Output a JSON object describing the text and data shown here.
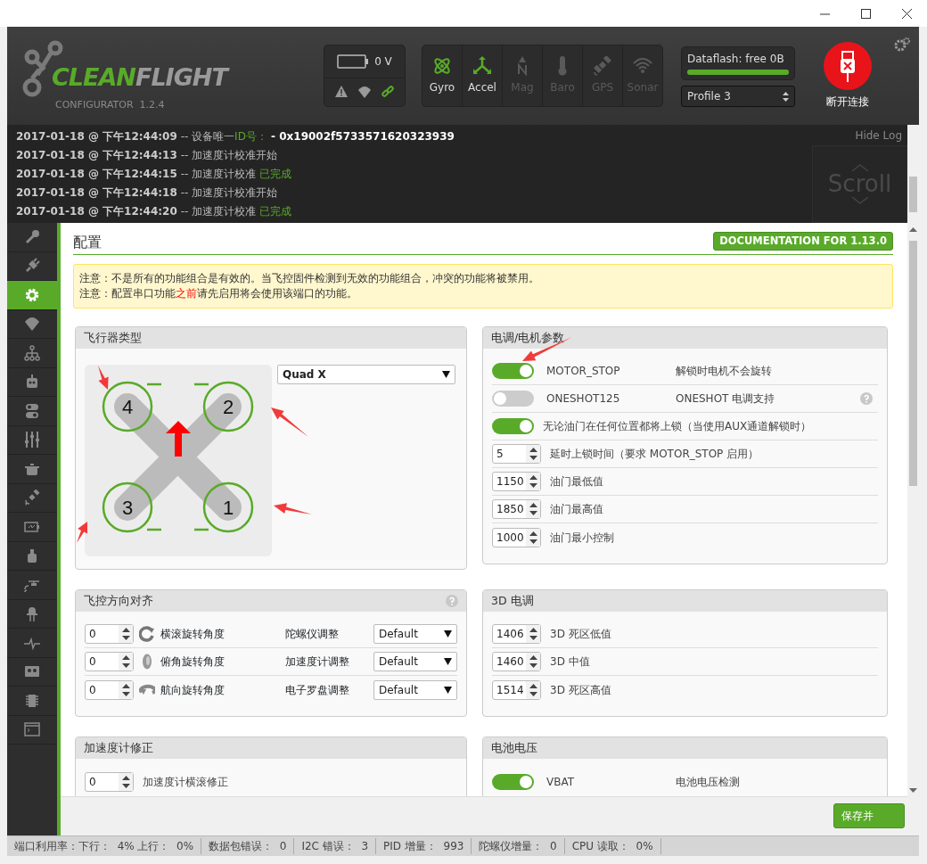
{
  "header": {
    "logo": {
      "part1": "CLEAN",
      "part2": "FLIGHT",
      "subtitle": "CONFIGURATOR  1.2.4"
    },
    "battery": {
      "reading": "0 V"
    },
    "sensors": [
      {
        "label": "Gyro",
        "active": true
      },
      {
        "label": "Accel",
        "active": true
      },
      {
        "label": "Mag",
        "active": false
      },
      {
        "label": "Baro",
        "active": false
      },
      {
        "label": "GPS",
        "active": false
      },
      {
        "label": "Sonar",
        "active": false
      }
    ],
    "dataflash": {
      "label": "Dataflash: free 0B",
      "level": 1
    },
    "profile": {
      "value": "Profile 3"
    },
    "disconnect": {
      "label": "断开连接"
    }
  },
  "log": {
    "hide_label": "Hide Log",
    "scroll_label": "Scroll",
    "lines": [
      {
        "parts": [
          {
            "kind": "time",
            "text": "2017-01-18 @ 下午12:44:09"
          },
          {
            "kind": "plain",
            "text": " -- 设备唯一"
          },
          {
            "kind": "ok",
            "text": "ID号："
          },
          {
            "kind": "strong",
            "text": " - 0x19002f5733571620323939"
          }
        ]
      },
      {
        "parts": [
          {
            "kind": "time",
            "text": "2017-01-18 @ 下午12:44:13"
          },
          {
            "kind": "plain",
            "text": " -- 加速度计校准开始"
          }
        ]
      },
      {
        "parts": [
          {
            "kind": "time",
            "text": "2017-01-18 @ 下午12:44:15"
          },
          {
            "kind": "plain",
            "text": " -- 加速度计校准 "
          },
          {
            "kind": "ok",
            "text": "已完成"
          }
        ]
      },
      {
        "parts": [
          {
            "kind": "time",
            "text": "2017-01-18 @ 下午12:44:18"
          },
          {
            "kind": "plain",
            "text": " -- 加速度计校准开始"
          }
        ]
      },
      {
        "parts": [
          {
            "kind": "time",
            "text": "2017-01-18 @ 下午12:44:20"
          },
          {
            "kind": "plain",
            "text": " -- 加速度计校准 "
          },
          {
            "kind": "ok",
            "text": "已完成"
          }
        ]
      }
    ]
  },
  "sidebar": {
    "items": [
      {
        "selected": false
      },
      {
        "selected": false
      },
      {
        "selected": true
      },
      {
        "selected": false
      },
      {
        "selected": false
      },
      {
        "selected": false
      },
      {
        "selected": false
      },
      {
        "selected": false
      },
      {
        "selected": false
      },
      {
        "selected": false
      },
      {
        "selected": false
      },
      {
        "selected": false
      },
      {
        "selected": false
      },
      {
        "selected": false
      },
      {
        "selected": false
      },
      {
        "selected": false
      },
      {
        "selected": false
      },
      {
        "selected": false
      }
    ]
  },
  "content": {
    "title": "配置",
    "doc_button": "DOCUMENTATION FOR 1.13.0",
    "notes": [
      {
        "parts": [
          {
            "kind": "plain",
            "text": "注意：不是所有的功能组合是有效的。当飞控固件检测到无效的功能组合，冲突的功能将被禁用。"
          }
        ]
      },
      {
        "parts": [
          {
            "kind": "plain",
            "text": "注意：配置串口功能"
          },
          {
            "kind": "alert",
            "text": "之前"
          },
          {
            "kind": "plain",
            "text": "请先启用将会使用该端口的功能。"
          }
        ]
      }
    ],
    "panels": [
      {
        "kind": "mixer",
        "title": "飞行器类型",
        "mixer": "Quad X",
        "motors": [
          "4",
          "2",
          "3",
          "1"
        ]
      },
      {
        "kind": "rows",
        "title": "电调/电机参数",
        "rows": [
          {
            "kind": "switch",
            "on": true,
            "name": "MOTOR_STOP",
            "description": "解锁时电机不会旋转"
          },
          {
            "kind": "switch",
            "on": false,
            "name": "ONESHOT125",
            "description": "ONESHOT 电调支持",
            "help": true
          },
          {
            "kind": "switch",
            "on": true,
            "description": "无论油门在任何位置都将上锁（当使用AUX通道解锁时）"
          },
          {
            "kind": "number",
            "value": "5",
            "label": "延时上锁时间（要求 MOTOR_STOP 启用）"
          },
          {
            "kind": "number",
            "value": "1150",
            "label": "油门最低值"
          },
          {
            "kind": "number",
            "value": "1850",
            "label": "油门最高值"
          },
          {
            "kind": "number",
            "value": "1000",
            "label": "油门最小控制"
          }
        ]
      },
      {
        "kind": "align",
        "title": "飞控方向对齐",
        "help": true,
        "rows": [
          {
            "value": "0",
            "label": "横滚旋转角度",
            "sensor": "陀螺仪调整",
            "select": "Default"
          },
          {
            "value": "0",
            "label": "俯角旋转角度",
            "sensor": "加速度计调整",
            "select": "Default"
          },
          {
            "value": "0",
            "label": "航向旋转角度",
            "sensor": "电子罗盘调整",
            "select": "Default"
          }
        ]
      },
      {
        "kind": "rows",
        "title": "3D 电调",
        "rows": [
          {
            "kind": "number",
            "value": "1406",
            "label": "3D 死区低值"
          },
          {
            "kind": "number",
            "value": "1460",
            "label": "3D 中值"
          },
          {
            "kind": "number",
            "value": "1514",
            "label": "3D 死区高值"
          }
        ]
      },
      {
        "kind": "rows",
        "title": "加速度计修正",
        "rows": [
          {
            "kind": "number",
            "value": "0",
            "label": "加速度计横滚修正"
          }
        ]
      },
      {
        "kind": "rows",
        "title": "电池电压",
        "rows": [
          {
            "kind": "switch",
            "on": true,
            "name": "VBAT",
            "description": "电池电压检测"
          }
        ]
      }
    ]
  },
  "save_button": "保存并",
  "status_bar": [
    "端口利用率：下行：  4% 上行：  0%",
    "数据包错误：  0",
    "I2C 错误：  3",
    "PID 增量：  993",
    "陀螺仪增量：  0",
    "CPU 读取：  0%"
  ],
  "annotations": [
    {
      "kind": "arrow"
    },
    {
      "kind": "arrow"
    },
    {
      "kind": "arrow"
    },
    {
      "kind": "arrow"
    },
    {
      "kind": "arrow"
    }
  ]
}
